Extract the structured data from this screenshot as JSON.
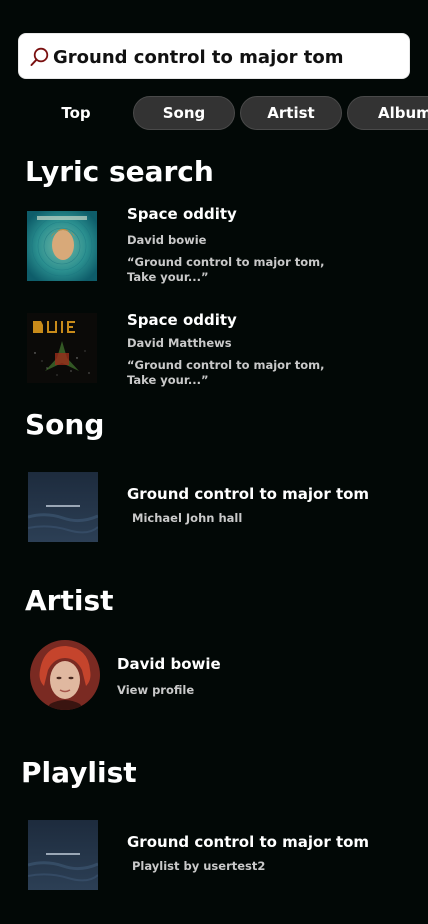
{
  "search": {
    "query": "Ground control to major tom",
    "icon": "search-icon"
  },
  "filters": {
    "top": "Top",
    "song": "Song",
    "artist": "Artist",
    "album": "Album"
  },
  "lyric_section": {
    "title": "Lyric search",
    "items": [
      {
        "title": "Space oddity",
        "artist": "David bowie",
        "lyric_line1": "“Ground control to major tom,",
        "lyric_line2": "Take your...”"
      },
      {
        "title": "Space oddity",
        "artist": "David Matthews",
        "lyric_line1": "“Ground control to major tom,",
        "lyric_line2": "Take your...”"
      }
    ]
  },
  "song_section": {
    "title": "Song",
    "item": {
      "title": "Ground control to major tom",
      "subtitle": "Michael John hall"
    }
  },
  "artist_section": {
    "title": "Artist",
    "item": {
      "name": "David bowie",
      "action": "View profile"
    }
  },
  "playlist_section": {
    "title": "Playlist",
    "item": {
      "title": "Ground control to major tom",
      "subtitle": "Playlist by usertest2"
    }
  },
  "colors": {
    "background": "#020806",
    "chip_bg": "#333333",
    "secondary_text": "#c9c9c9"
  }
}
